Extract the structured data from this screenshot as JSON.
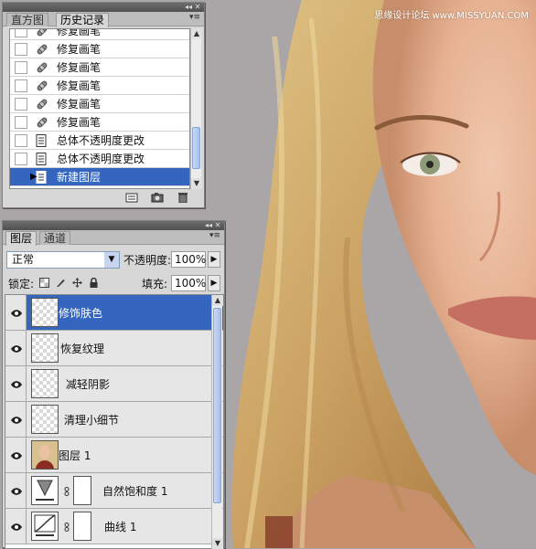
{
  "watermark": "思缘设计论坛 www.MISSYUAN.COM",
  "history_panel": {
    "tabs": [
      "直方图",
      "历史记录"
    ],
    "active_tab": 1,
    "items": [
      {
        "label": "修复画笔",
        "icon": "healing-brush-icon"
      },
      {
        "label": "修复画笔",
        "icon": "healing-brush-icon"
      },
      {
        "label": "修复画笔",
        "icon": "healing-brush-icon"
      },
      {
        "label": "修复画笔",
        "icon": "healing-brush-icon"
      },
      {
        "label": "修复画笔",
        "icon": "healing-brush-icon"
      },
      {
        "label": "修复画笔",
        "icon": "healing-brush-icon"
      },
      {
        "label": "总体不透明度更改",
        "icon": "history-state-icon"
      },
      {
        "label": "总体不透明度更改",
        "icon": "history-state-icon"
      },
      {
        "label": "新建图层",
        "icon": "history-state-icon"
      }
    ],
    "selected_index": 8
  },
  "layers_panel": {
    "tabs": [
      "图层",
      "通道"
    ],
    "active_tab": 0,
    "blend_mode": "正常",
    "opacity_label": "不透明度:",
    "opacity_value": "100%",
    "lock_label": "锁定:",
    "fill_label": "填充:",
    "fill_value": "100%",
    "layers": [
      {
        "name": "修饰肤色",
        "thumb": "transparent",
        "selected": true
      },
      {
        "name": "恢复纹理",
        "thumb": "transparent"
      },
      {
        "name": "减轻阴影",
        "thumb": "transparent"
      },
      {
        "name": "清理小细节",
        "thumb": "transparent"
      },
      {
        "name": "图层 1",
        "thumb": "photo"
      },
      {
        "name": "自然饱和度 1",
        "thumb": "vibrance-adjustment"
      },
      {
        "name": "曲线 1",
        "thumb": "curves-adjustment"
      }
    ]
  },
  "colors": {
    "selection": "#3466c0",
    "panel_bg": "#d7d7d7"
  }
}
